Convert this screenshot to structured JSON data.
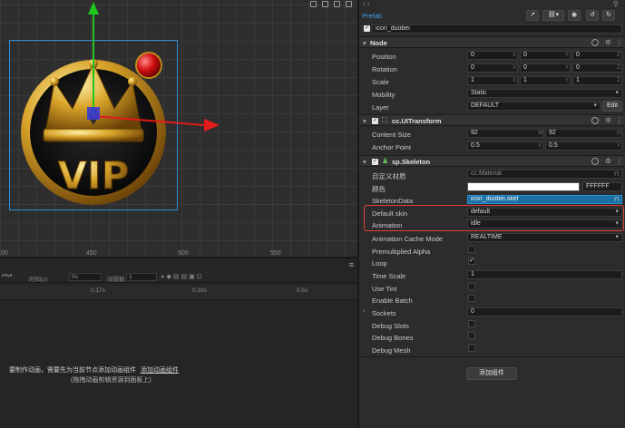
{
  "scene": {
    "ruler_labels": [
      "00",
      "450",
      "500",
      "550"
    ],
    "logo_text": "VIP"
  },
  "timeline": {
    "time_label": "时间(s)",
    "time_value": "0s",
    "interval_label": "间隔数",
    "interval_value": "1",
    "ticks": [
      "0.17s",
      "0.33s",
      "0.5s"
    ],
    "message_prefix": "要制作动画，需要先为当前节点添加动画组件",
    "message_link": "添加动画组件",
    "message_hint": "(拖拽动画剪辑资源到面板上)"
  },
  "inspector": {
    "prefab_label": "Prefab",
    "node_name": "icon_duobei",
    "node_section": {
      "title": "Node",
      "position_label": "Position",
      "position": [
        "0",
        "0",
        "0"
      ],
      "rotation_label": "Rotation",
      "rotation": [
        "0",
        "0",
        "0"
      ],
      "scale_label": "Scale",
      "scale": [
        "1",
        "1",
        "1"
      ],
      "axis": [
        "X",
        "Y",
        "Z"
      ],
      "mobility_label": "Mobility",
      "mobility_value": "Static",
      "layer_label": "Layer",
      "layer_value": "DEFAULT",
      "edit_label": "Edit"
    },
    "uitransform": {
      "title": "cc.UITransform",
      "content_size_label": "Content Size",
      "content_size": [
        "92",
        "92"
      ],
      "wh": [
        "W",
        "H"
      ],
      "anchor_label": "Anchor Point",
      "anchor": [
        "0.5",
        "0.5"
      ],
      "xy": [
        "X",
        "Y"
      ]
    },
    "skeleton": {
      "title": "sp.Skeleton",
      "custom_material_label": "自定义材质",
      "custom_material_value": "cc.Material",
      "color_label": "颜色",
      "color_value": "FFFFFF",
      "skeleton_data_label": "SkeletonData",
      "skeleton_data_value": "icon_duobei.skel",
      "default_skin_label": "Default skin",
      "default_skin_value": "default",
      "animation_label": "Animation",
      "animation_value": "idle",
      "cache_mode_label": "Animation Cache Mode",
      "cache_mode_value": "REALTIME",
      "premultiplied_label": "Premultiplied Alpha",
      "loop_label": "Loop",
      "time_scale_label": "Time Scale",
      "time_scale_value": "1",
      "use_tint_label": "Use Tint",
      "enable_batch_label": "Enable Batch",
      "sockets_label": "Sockets",
      "sockets_value": "0",
      "debug_slots_label": "Debug Slots",
      "debug_bones_label": "Debug Bones",
      "debug_mesh_label": "Debug Mesh"
    },
    "add_component_label": "添加组件"
  },
  "colors": {
    "accent_blue": "#2d8fd5",
    "highlight_red": "#e0403a",
    "gizmo_green": "#1ec71e",
    "gizmo_red": "#e31b1b",
    "selected_field": "#1a6fa3"
  }
}
